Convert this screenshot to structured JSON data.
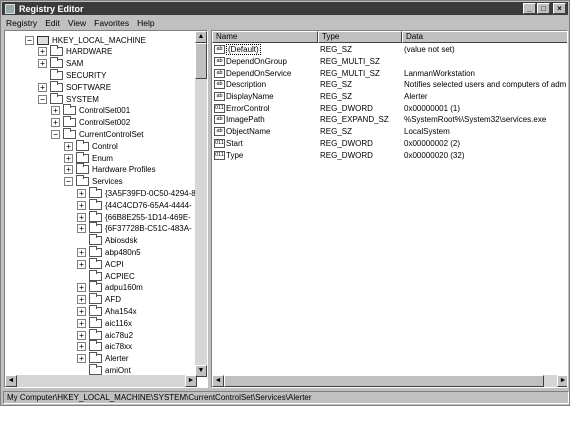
{
  "window": {
    "title": "Registry Editor"
  },
  "window_buttons": [
    "_",
    "□",
    "×"
  ],
  "menu": [
    "Registry",
    "Edit",
    "View",
    "Favorites",
    "Help"
  ],
  "tree": [
    {
      "label": "HKEY_LOCAL_MACHINE",
      "toggle": "−",
      "level": 0,
      "icon": "computer-icon"
    },
    {
      "label": "HARDWARE",
      "toggle": "+",
      "level": 1,
      "icon": "folder-icon"
    },
    {
      "label": "SAM",
      "toggle": "+",
      "level": 1,
      "icon": "folder-icon"
    },
    {
      "label": "SECURITY",
      "toggle": "",
      "level": 1,
      "icon": "folder-icon"
    },
    {
      "label": "SOFTWARE",
      "toggle": "+",
      "level": 1,
      "icon": "folder-icon"
    },
    {
      "label": "SYSTEM",
      "toggle": "−",
      "level": 1,
      "icon": "folder-icon"
    },
    {
      "label": "ControlSet001",
      "toggle": "+",
      "level": 2,
      "icon": "folder-icon"
    },
    {
      "label": "ControlSet002",
      "toggle": "+",
      "level": 2,
      "icon": "folder-icon"
    },
    {
      "label": "CurrentControlSet",
      "toggle": "−",
      "level": 2,
      "icon": "folder-icon"
    },
    {
      "label": "Control",
      "toggle": "+",
      "level": 3,
      "icon": "folder-icon"
    },
    {
      "label": "Enum",
      "toggle": "+",
      "level": 3,
      "icon": "folder-icon"
    },
    {
      "label": "Hardware Profiles",
      "toggle": "+",
      "level": 3,
      "icon": "folder-icon"
    },
    {
      "label": "Services",
      "toggle": "−",
      "level": 3,
      "icon": "folder-icon"
    },
    {
      "label": "{3A5F39FD-0C50-4294-8",
      "toggle": "+",
      "level": 4,
      "icon": "folder-icon"
    },
    {
      "label": "{44C4CD76-65A4-4444-",
      "toggle": "+",
      "level": 4,
      "icon": "folder-icon"
    },
    {
      "label": "{66B8E255-1D14-469E-",
      "toggle": "+",
      "level": 4,
      "icon": "folder-icon"
    },
    {
      "label": "{6F37728B-C51C-483A-",
      "toggle": "+",
      "level": 4,
      "icon": "folder-icon"
    },
    {
      "label": "Abiosdsk",
      "toggle": "",
      "level": 4,
      "icon": "folder-icon"
    },
    {
      "label": "abp480n5",
      "toggle": "+",
      "level": 4,
      "icon": "folder-icon"
    },
    {
      "label": "ACPI",
      "toggle": "+",
      "level": 4,
      "icon": "folder-icon"
    },
    {
      "label": "ACPIEC",
      "toggle": "",
      "level": 4,
      "icon": "folder-icon"
    },
    {
      "label": "adpu160m",
      "toggle": "+",
      "level": 4,
      "icon": "folder-icon"
    },
    {
      "label": "AFD",
      "toggle": "+",
      "level": 4,
      "icon": "folder-icon"
    },
    {
      "label": "Aha154x",
      "toggle": "+",
      "level": 4,
      "icon": "folder-icon"
    },
    {
      "label": "aic116x",
      "toggle": "+",
      "level": 4,
      "icon": "folder-icon"
    },
    {
      "label": "aic78u2",
      "toggle": "+",
      "level": 4,
      "icon": "folder-icon"
    },
    {
      "label": "aic78xx",
      "toggle": "+",
      "level": 4,
      "icon": "folder-icon"
    },
    {
      "label": "Alerter",
      "toggle": "+",
      "level": 4,
      "icon": "folder-icon"
    },
    {
      "label": "amiOnt",
      "toggle": "",
      "level": 4,
      "icon": "folder-icon"
    }
  ],
  "columns": [
    "Name",
    "Type",
    "Data"
  ],
  "values": [
    {
      "name": "(Default)",
      "type": "REG_SZ",
      "data": "(value not set)",
      "icon": "ab"
    },
    {
      "name": "DependOnGroup",
      "type": "REG_MULTI_SZ",
      "data": "",
      "icon": "ab"
    },
    {
      "name": "DependOnService",
      "type": "REG_MULTI_SZ",
      "data": "LanmanWorkstation",
      "icon": "ab"
    },
    {
      "name": "Description",
      "type": "REG_SZ",
      "data": "Notifies selected users and computers of adm",
      "icon": "ab"
    },
    {
      "name": "DisplayName",
      "type": "REG_SZ",
      "data": "Alerter",
      "icon": "ab"
    },
    {
      "name": "ErrorControl",
      "type": "REG_DWORD",
      "data": "0x00000001 (1)",
      "icon": "011"
    },
    {
      "name": "ImagePath",
      "type": "REG_EXPAND_SZ",
      "data": "%SystemRoot%\\System32\\services.exe",
      "icon": "ab"
    },
    {
      "name": "ObjectName",
      "type": "REG_SZ",
      "data": "LocalSystem",
      "icon": "ab"
    },
    {
      "name": "Start",
      "type": "REG_DWORD",
      "data": "0x00000002 (2)",
      "icon": "011"
    },
    {
      "name": "Type",
      "type": "REG_DWORD",
      "data": "0x00000020 (32)",
      "icon": "011"
    }
  ],
  "status": "My Computer\\HKEY_LOCAL_MACHINE\\SYSTEM\\CurrentControlSet\\Services\\Alerter",
  "scroll_arrows": {
    "up": "▲",
    "down": "▼",
    "left": "◄",
    "right": "►"
  }
}
